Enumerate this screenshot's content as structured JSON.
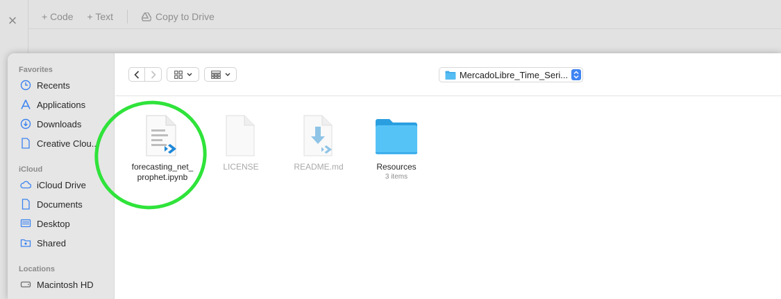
{
  "background": {
    "toolbar": {
      "code_label": "+ Code",
      "text_label": "+ Text",
      "drive_label": "Copy to Drive"
    }
  },
  "sidebar": {
    "sections": [
      {
        "title": "Favorites",
        "items": [
          {
            "label": "Recents",
            "icon": "clock-icon"
          },
          {
            "label": "Applications",
            "icon": "applications-icon"
          },
          {
            "label": "Downloads",
            "icon": "download-icon"
          },
          {
            "label": "Creative Clou...",
            "icon": "document-icon"
          }
        ]
      },
      {
        "title": "iCloud",
        "items": [
          {
            "label": "iCloud Drive",
            "icon": "cloud-icon"
          },
          {
            "label": "Documents",
            "icon": "document-icon"
          },
          {
            "label": "Desktop",
            "icon": "desktop-icon"
          },
          {
            "label": "Shared",
            "icon": "shared-folder-icon"
          }
        ]
      },
      {
        "title": "Locations",
        "items": [
          {
            "label": "Macintosh HD",
            "icon": "hard-drive-icon"
          }
        ]
      }
    ]
  },
  "toolbar": {
    "path_label": "MercadoLibre_Time_Seri...",
    "accent_color": "#3f84f2"
  },
  "files": [
    {
      "name_line1": "forecasting_net_",
      "name_line2": "prophet.ipynb",
      "icon": "notebook-file-icon",
      "dimmed": false
    },
    {
      "name_line1": "LICENSE",
      "name_line2": "",
      "icon": "blank-file-icon",
      "dimmed": true
    },
    {
      "name_line1": "README.md",
      "name_line2": "",
      "icon": "markdown-file-icon",
      "dimmed": true
    },
    {
      "name_line1": "Resources",
      "name_line2": "",
      "sub": "3 items",
      "icon": "folder-icon",
      "dimmed": false
    }
  ],
  "highlight_color": "#2fe33a"
}
